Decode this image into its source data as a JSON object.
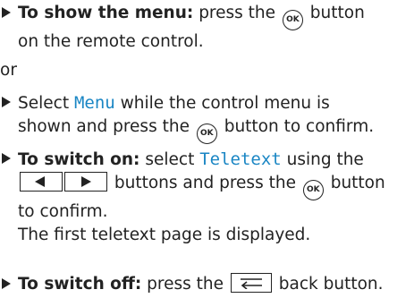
{
  "ok_label": "OK",
  "step1": {
    "heading": "To show the menu:",
    "text_a": " press the ",
    "text_b": " button",
    "line2": "on the remote control."
  },
  "or_text": "or",
  "step2": {
    "text_a": "Select ",
    "menu_word": "Menu",
    "text_b": " while the control menu is",
    "line2_a": "shown and press the ",
    "line2_b": " button to confirm."
  },
  "step3": {
    "heading": "To switch on:",
    "text_a": " select ",
    "teletext_word": "Teletext",
    "text_b": " using the",
    "line2_b": " buttons and press the ",
    "line2_c": " button",
    "line3": "to confirm.",
    "line4": "The first teletext page is displayed."
  },
  "step4": {
    "heading": "To switch off:",
    "text_a": " press the ",
    "text_b": " back button."
  },
  "icons": {
    "bullet": "triangle-right",
    "ok": "ok-button-circle",
    "left_key": "left-arrow-key",
    "right_key": "right-arrow-key",
    "back": "back-key"
  },
  "colors": {
    "highlight": "#1a86c4",
    "text": "#222222"
  }
}
